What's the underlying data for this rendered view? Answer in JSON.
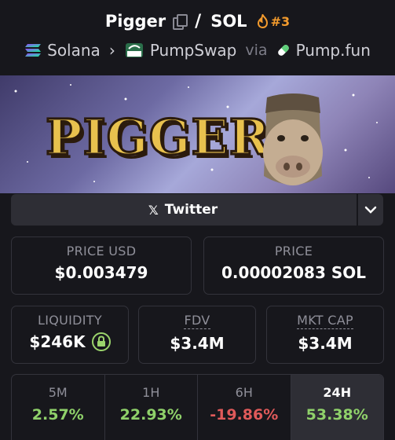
{
  "header": {
    "token": "Pigger",
    "separator": "/",
    "quote": "SOL",
    "rank": "#3",
    "chain": "Solana",
    "dex": "PumpSwap",
    "via": "via",
    "launchpad": "Pump.fun"
  },
  "banner": {
    "logo_text": "PIGGER"
  },
  "social": {
    "twitter_label": "Twitter"
  },
  "stats": {
    "price_usd_label": "PRICE USD",
    "price_usd": "$0.003479",
    "price_label": "PRICE",
    "price_sol": "0.00002083 SOL",
    "liquidity_label": "LIQUIDITY",
    "liquidity": "$246K",
    "fdv_label": "FDV",
    "fdv": "$3.4M",
    "mktcap_label": "MKT CAP",
    "mktcap": "$3.4M"
  },
  "periods": [
    {
      "label": "5M",
      "change": "2.57%"
    },
    {
      "label": "1H",
      "change": "22.93%"
    },
    {
      "label": "6H",
      "change": "-19.86%"
    },
    {
      "label": "24H",
      "change": "53.38%"
    }
  ],
  "colors": {
    "positive": "#8fd16a",
    "negative": "#e05a5a",
    "rank": "#f39b2d",
    "background": "#17171c"
  }
}
